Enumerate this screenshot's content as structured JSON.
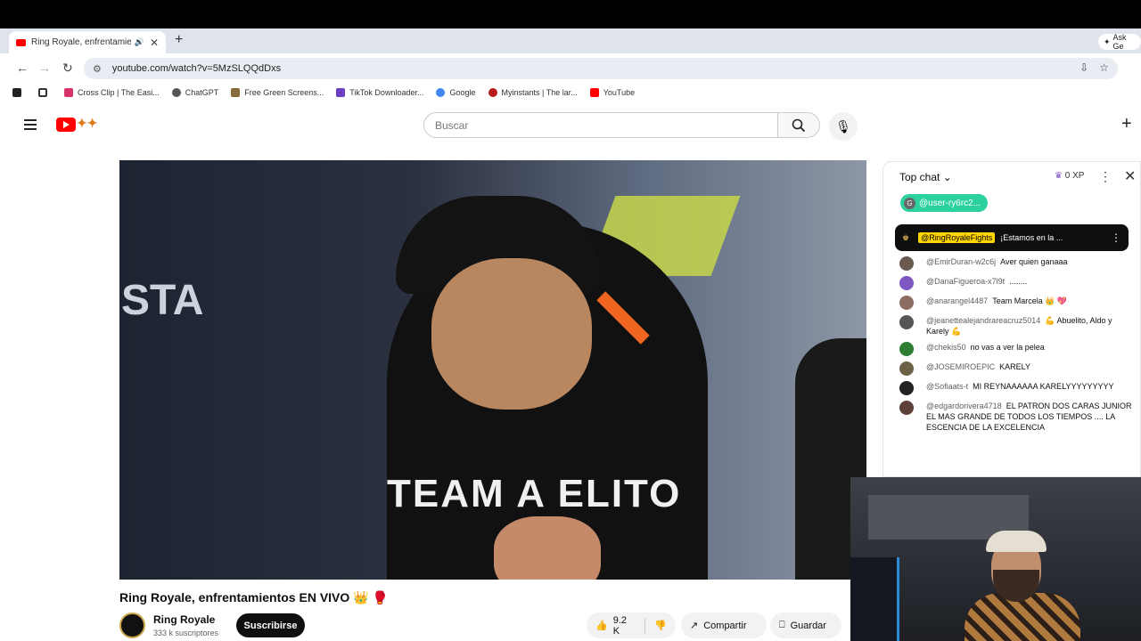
{
  "browser": {
    "tab_title": "Ring Royale, enfrentamient",
    "url": "youtube.com/watch?v=5MzSLQQdDxs",
    "new_tab": "+",
    "ask": "Ask Ge",
    "bookmarks": [
      "Cross Clip | The Easi...",
      "ChatGPT",
      "Free Green Screens...",
      "TikTok Downloader...",
      "Google",
      "Myinstants | The lar...",
      "YouTube"
    ]
  },
  "youtube": {
    "search_placeholder": "Buscar",
    "video_title": "Ring Royale, enfrentamientos EN VIVO",
    "channel_name": "Ring Royale",
    "subscribers": "333 k suscriptores",
    "subscribe_label": "Suscribirse",
    "likes": "9.2 K",
    "share_label": "Compartir",
    "save_label": "Guardar",
    "video_text": "TEAM A ELITO",
    "video_sta": "STA"
  },
  "chat": {
    "mode": "Top chat",
    "xp": "0 XP",
    "user_pill": "@user-ry6rc2...",
    "pinned_user": "@RingRoyaleFights",
    "pinned_text": "¡Estamos en la ...",
    "messages": [
      {
        "user": "@EmirDuran-w2c6j",
        "text": "Aver quien ganaaa",
        "color": "#6b5a4f"
      },
      {
        "user": "@DanaFigueroa-x7l9t",
        "text": "........",
        "color": "#7e57c2"
      },
      {
        "user": "@anarangel4487",
        "text": "Team Marcela 👑 💖",
        "color": "#8d6e63"
      },
      {
        "user": "@jeanettealejandrareacruz5014",
        "text": "💪 Abuelito, Aldo y Karely 💪",
        "color": "#555"
      },
      {
        "user": "@chekis50",
        "text": "no vas a ver la pelea",
        "color": "#2e7d32"
      },
      {
        "user": "@JOSEMIROEPIC",
        "text": "KARELY",
        "color": "#6d6248"
      },
      {
        "user": "@Sofiaats-t",
        "text": "MI REYNAAAAAA KARELYYYYYYYYY",
        "color": "#222"
      },
      {
        "user": "@edgardorivera4718",
        "text": "EL PATRON DOS CARAS JUNIOR EL MAS GRANDE DE TODOS LOS TIEMPOS .... LA ESCENCIA DE LA EXCELENCIA",
        "color": "#5d4037"
      }
    ]
  }
}
